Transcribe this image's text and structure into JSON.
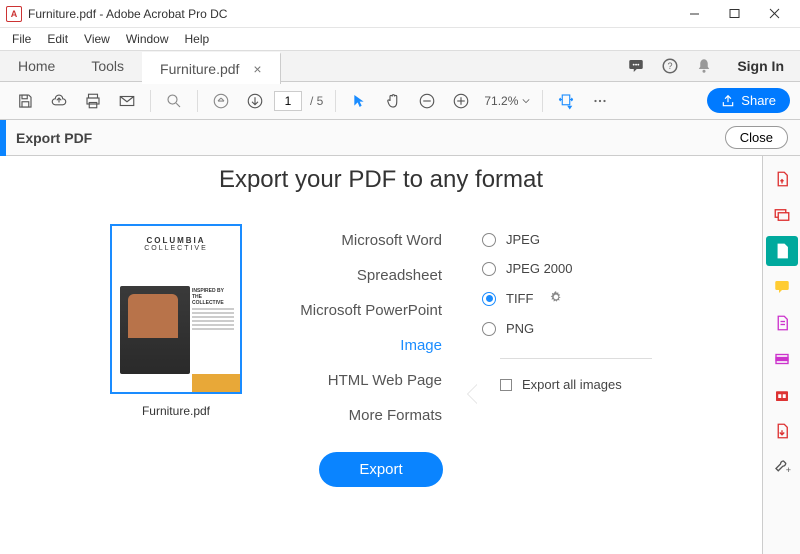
{
  "titlebar": {
    "app_icon_text": "A",
    "title": "Furniture.pdf - Adobe Acrobat Pro DC"
  },
  "menu": {
    "items": [
      "File",
      "Edit",
      "View",
      "Window",
      "Help"
    ]
  },
  "viewtabs": {
    "home": "Home",
    "tools": "Tools",
    "doc": "Furniture.pdf",
    "signin": "Sign In"
  },
  "toolbar": {
    "page_current": "1",
    "page_total": "/ 5",
    "zoom": "71.2%",
    "share": "Share"
  },
  "exportbar": {
    "title": "Export PDF",
    "close": "Close"
  },
  "panel": {
    "heading": "Export your PDF to any format",
    "thumb": {
      "brand1": "COLUMBIA",
      "brand2": "COLLECTIVE",
      "tag": "INSPIRED BY THE COLLECTIVE"
    },
    "thumb_label": "Furniture.pdf",
    "formats": [
      "Microsoft Word",
      "Spreadsheet",
      "Microsoft PowerPoint",
      "Image",
      "HTML Web Page",
      "More Formats"
    ],
    "format_selected_index": 3,
    "image_options": [
      "JPEG",
      "JPEG 2000",
      "TIFF",
      "PNG"
    ],
    "image_selected_index": 2,
    "export_all": "Export all images",
    "export_btn": "Export"
  }
}
